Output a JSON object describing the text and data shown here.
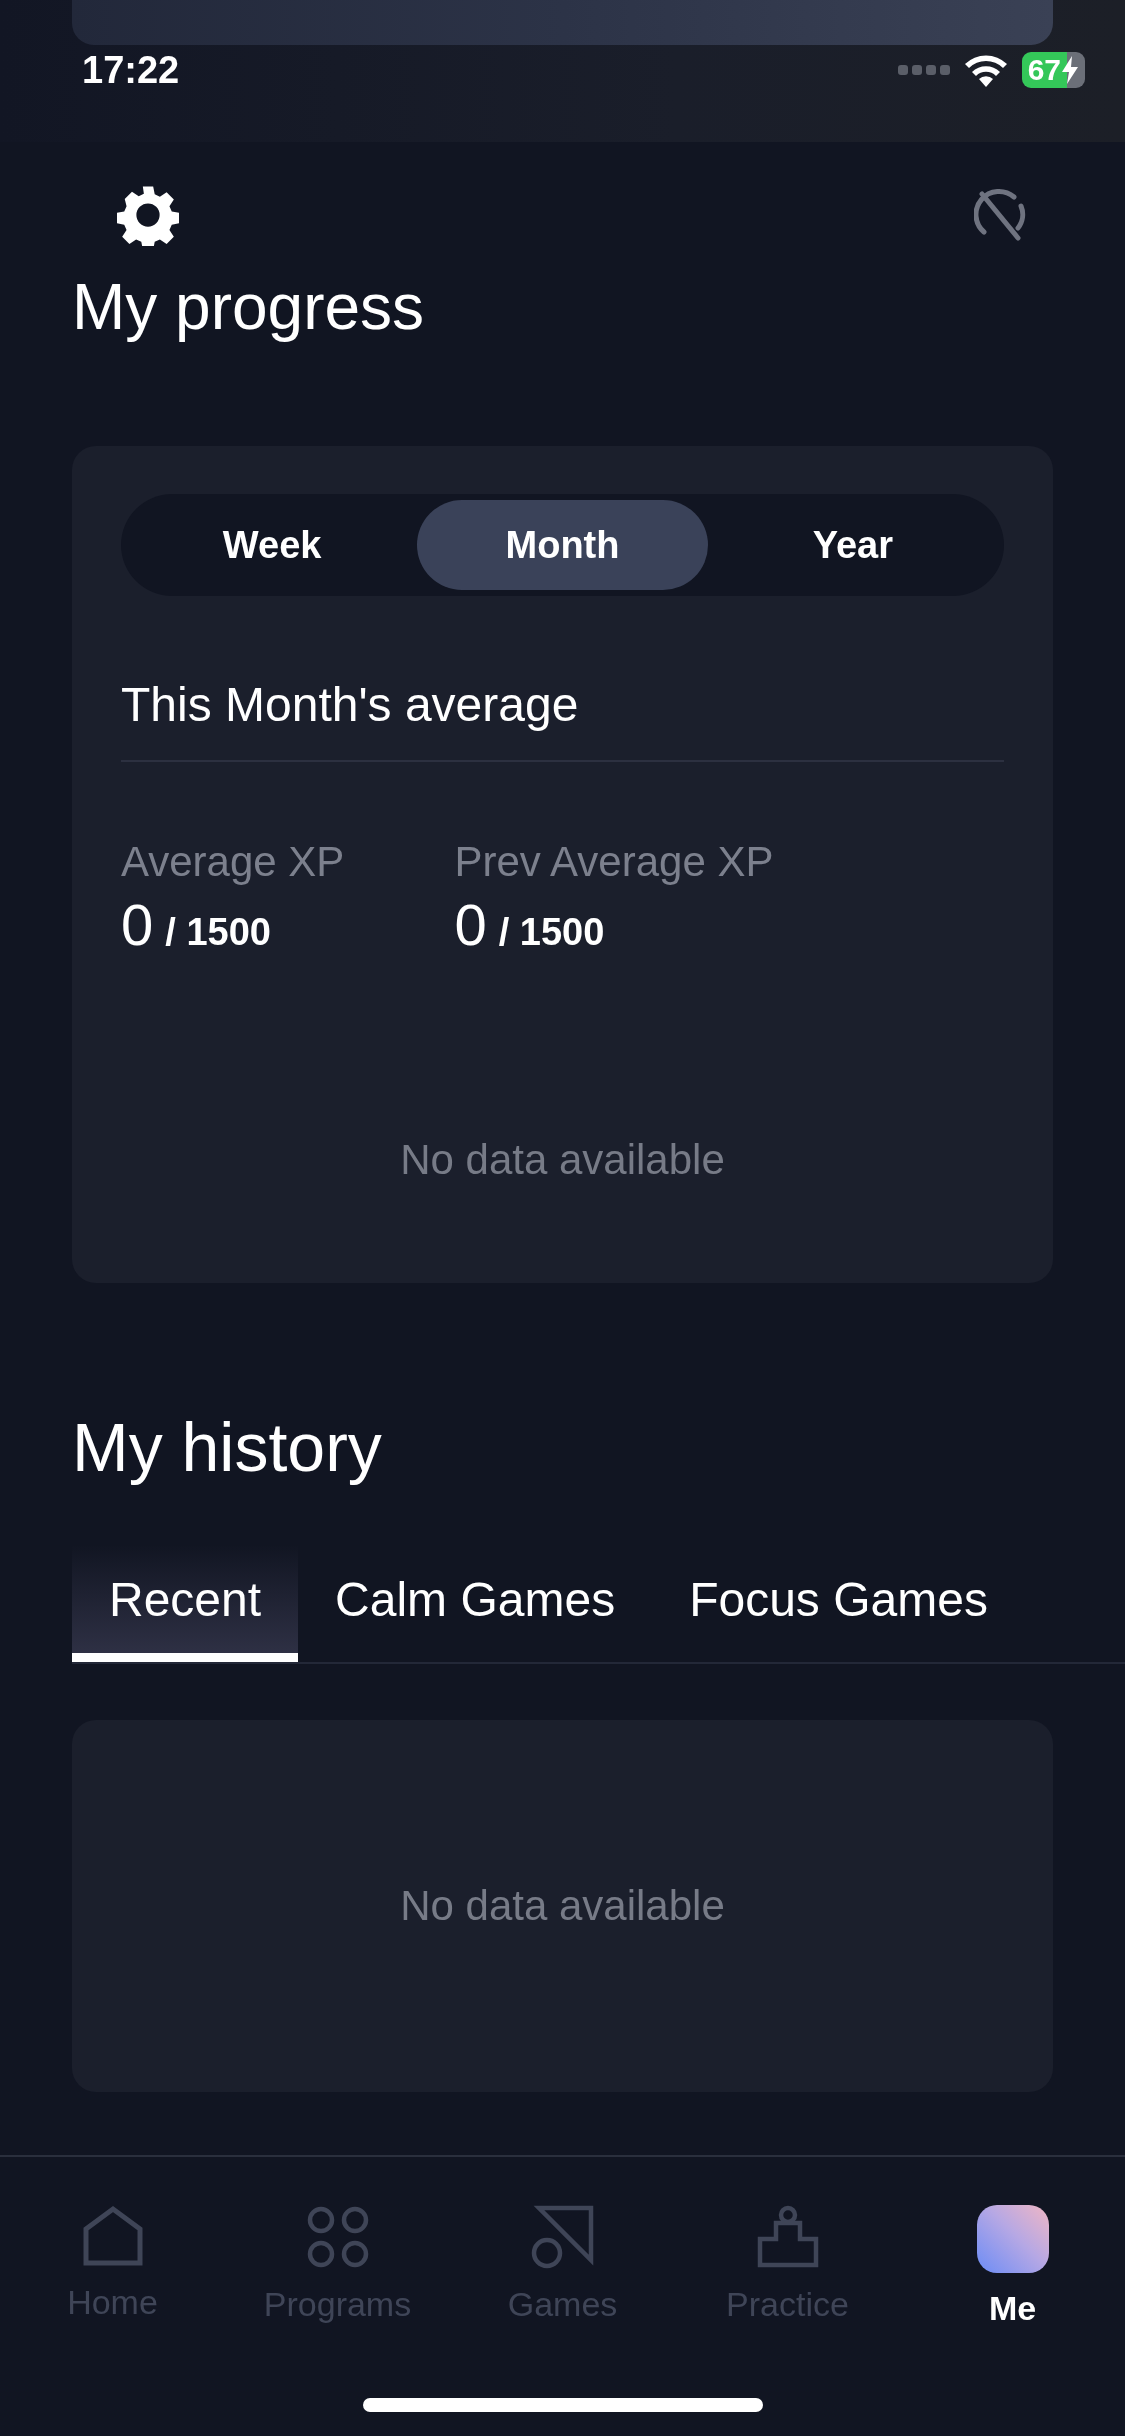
{
  "status_bar": {
    "time": "17:22",
    "battery": "67"
  },
  "title": "My progress",
  "progress": {
    "periods": [
      {
        "label": "Week",
        "selected": false
      },
      {
        "label": "Month",
        "selected": true
      },
      {
        "label": "Year",
        "selected": false
      }
    ],
    "average_title": "This Month's average",
    "stats": [
      {
        "label": "Average XP",
        "value": "0",
        "total": "/ 1500"
      },
      {
        "label": "Prev Average XP",
        "value": "0",
        "total": "/ 1500"
      }
    ],
    "empty_message": "No data available"
  },
  "history": {
    "title": "My history",
    "tabs": [
      {
        "label": "Recent",
        "selected": true
      },
      {
        "label": "Calm Games",
        "selected": false
      },
      {
        "label": "Focus Games",
        "selected": false
      }
    ],
    "empty_message": "No data available"
  },
  "nav": [
    {
      "label": "Home",
      "kind": "home",
      "selected": false
    },
    {
      "label": "Programs",
      "kind": "programs",
      "selected": false
    },
    {
      "label": "Games",
      "kind": "games",
      "selected": false
    },
    {
      "label": "Practice",
      "kind": "practice",
      "selected": false
    },
    {
      "label": "Me",
      "kind": "me",
      "selected": true
    }
  ]
}
